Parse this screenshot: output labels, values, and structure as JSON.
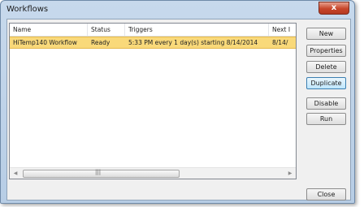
{
  "window": {
    "title": "Workflows",
    "close_glyph": "x"
  },
  "list": {
    "columns": [
      "Name",
      "Status",
      "Triggers",
      "Next I"
    ],
    "rows": [
      {
        "name": "HiTemp140 Workflow",
        "status": "Ready",
        "triggers": "5:33 PM every 1 day(s) starting 8/14/2014",
        "next": "8/14/"
      }
    ],
    "selected_row_color": "#f9d97a",
    "scrollbar": {
      "left_arrow": "◀",
      "right_arrow": "▶",
      "thumb_grip": "|||"
    }
  },
  "buttons": {
    "new": "New",
    "properties": "Properties",
    "delete": "Delete",
    "duplicate": "Duplicate",
    "disable": "Disable",
    "run": "Run",
    "close": "Close"
  }
}
